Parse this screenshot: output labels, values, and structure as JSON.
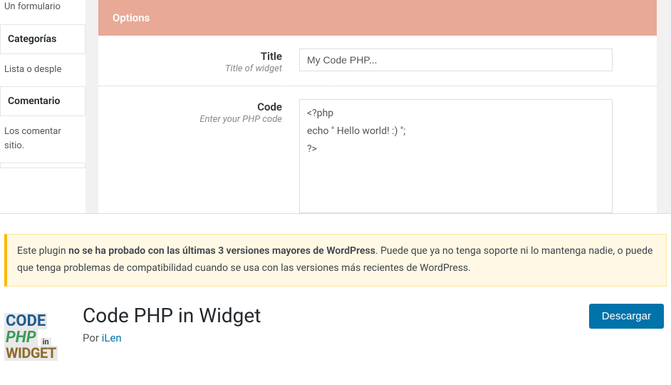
{
  "sidebar": {
    "truncated_text": "Un formulario",
    "categorias": {
      "title": "Categorías",
      "desc": "Lista o desple"
    },
    "comentarios": {
      "title": "Comentario",
      "desc": "Los comentar sitio."
    }
  },
  "options": {
    "header": "Options",
    "title": {
      "label": "Title",
      "sublabel": "Title of widget",
      "value": "My Code PHP..."
    },
    "code": {
      "label": "Code",
      "sublabel": "Enter your PHP code",
      "value": "<?php\necho \" Hello world! :) \";\n?>"
    }
  },
  "notice": {
    "prefix": "Este plugin ",
    "bold": "no se ha probado con las últimas 3 versiones mayores de WordPress",
    "suffix": ". Puede que ya no tenga soporte ni lo mantenga nadie, o puede que tenga problemas de compatibilidad cuando se usa con las versiones más recientes de WordPress."
  },
  "plugin": {
    "icon_row1": "CODE",
    "icon_php": "PHP",
    "icon_in": "in",
    "icon_row3": "WIDGET",
    "title": "Code PHP in Widget",
    "author_prefix": "Por ",
    "author": "iLen",
    "download": "Descargar"
  }
}
